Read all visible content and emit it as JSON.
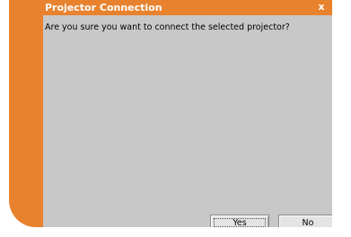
{
  "dialog": {
    "title": "Projector Connection",
    "close_glyph": "x",
    "message": "Are you sure you want to connect the selected projector?",
    "buttons": {
      "yes_label": "Yes",
      "no_label": "No"
    }
  },
  "colors": {
    "frame_orange": "#e8822f",
    "client_gray": "#c8c8c8",
    "title_text": "#ffffff"
  },
  "icons": {
    "close": "close-icon"
  }
}
